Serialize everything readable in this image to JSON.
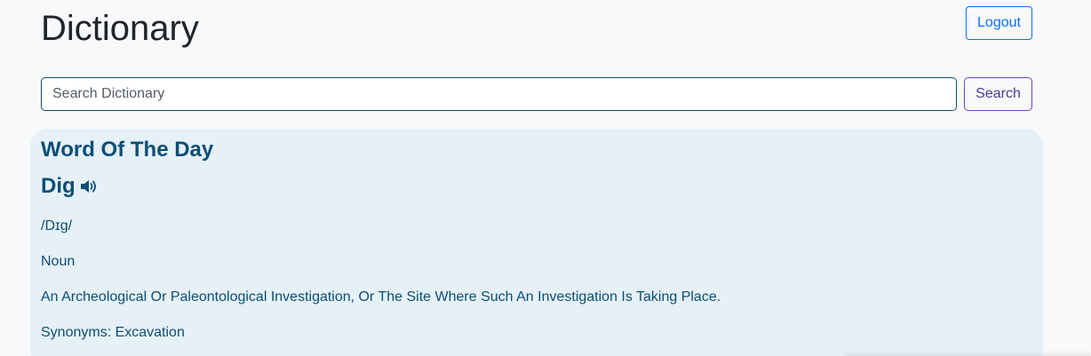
{
  "header": {
    "title": "Dictionary",
    "logout_label": "Logout"
  },
  "search": {
    "placeholder": "Search Dictionary",
    "value": "",
    "button_label": "Search"
  },
  "word_of_the_day": {
    "heading": "Word Of The Day",
    "word": "Dig",
    "audio_icon": "speaker-icon",
    "phonetic": "/Dɪg/",
    "part_of_speech": "Noun",
    "definition": "An Archeological Or Paleontological Investigation, Or The Site Where Such An Investigation Is Taking Place.",
    "synonyms": "Synonyms: Excavation"
  },
  "colors": {
    "accent": "#0d6efd",
    "heading": "#0b4f76",
    "card_background": "#e6f0f7"
  }
}
